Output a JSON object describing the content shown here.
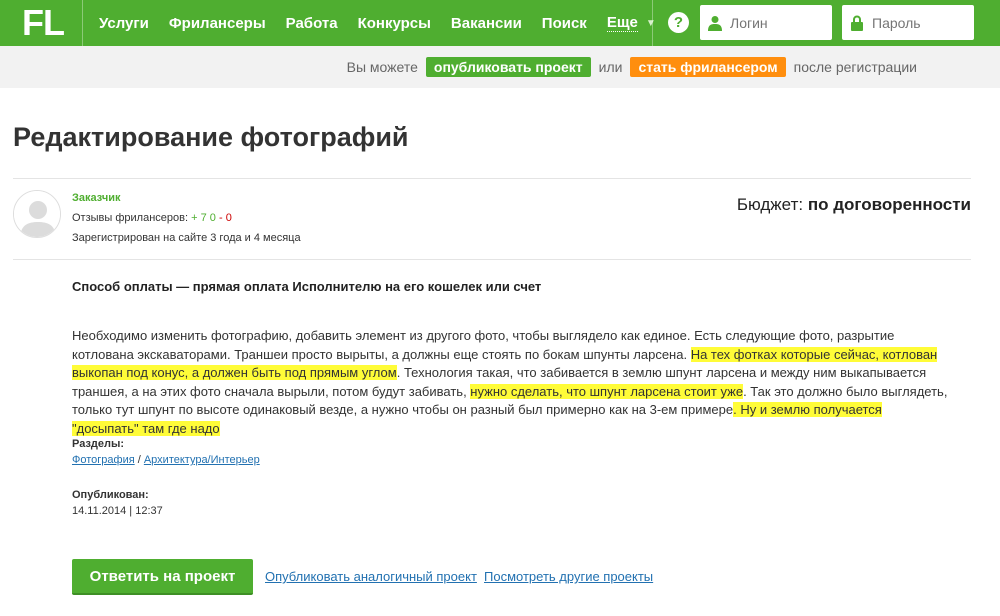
{
  "header": {
    "logo": "FL",
    "nav": [
      "Услуги",
      "Фрилансеры",
      "Работа",
      "Конкурсы",
      "Вакансии",
      "Поиск"
    ],
    "more": "Еще",
    "help": "?",
    "login_placeholder": "Логин",
    "password_placeholder": "Пароль",
    "accent_color": "#4fae30"
  },
  "subbar": {
    "prefix": "Вы можете",
    "publish_btn": "опубликовать проект",
    "or": "или",
    "freelancer_btn": "стать фрилансером",
    "suffix": "после регистрации"
  },
  "project": {
    "title": "Редактирование фотографий",
    "customer": {
      "role": "Заказчик",
      "reviews_label": "Отзывы фрилансеров:",
      "reviews_pos": "+ 7",
      "reviews_neutral": "0",
      "reviews_neg": "0",
      "registered": "Зарегистрирован на сайте 3 года и 4 месяца"
    },
    "budget_label": "Бюджет:",
    "budget_value": "по договоренности",
    "payment": "Способ оплаты — прямая оплата Исполнителю на его кошелек или счет",
    "description": {
      "p1": "Необходимо изменить фотографию, добавить элемент из другого фото, чтобы выглядело как единое. Есть следующие фото, разрытие котлована экскаваторами. Траншеи просто вырыты, а должны еще стоять по бокам шпунты ларсена. ",
      "h1": "На тех фотках которые сейчас, котлован выкопан под конус, а должен быть под прямым углом",
      "p2": ". Технология такая, что забивается в землю шпунт ларсена и между ним выкапывается траншея, а на этих фото сначала вырыли, потом будут забивать, ",
      "h2": "нужно сделать, что шпунт ларсена стоит уже",
      "p3": ". Так это должно было выглядеть, только тут шпунт по высоте одинаковый везде, а нужно чтобы он разный был примерно как на 3-ем примере",
      "h3": ". Ну и землю получается \"досыпать\" там где надо"
    },
    "sections_label": "Разделы:",
    "section_1": "Фотография",
    "section_sep": " / ",
    "section_2": "Архитектура/Интерьер",
    "published_label": "Опубликован:",
    "published_value": "14.11.2014 | 12:37"
  },
  "actions": {
    "reply": "Ответить на проект",
    "publish_similar": "Опубликовать аналогичный проект",
    "view_other": "Посмотреть другие проекты"
  }
}
